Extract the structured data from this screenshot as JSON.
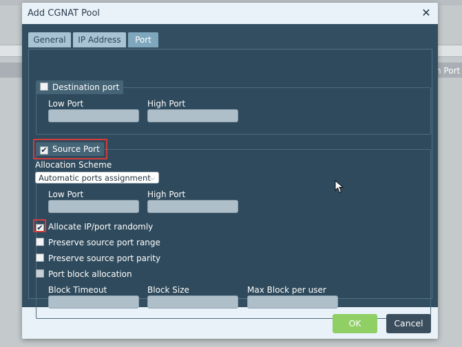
{
  "background": {
    "column_header": "n Port"
  },
  "dialog": {
    "title": "Add CGNAT Pool",
    "close_glyph": "✕",
    "tabs": [
      {
        "label": "General",
        "active": false
      },
      {
        "label": "IP Address",
        "active": false
      },
      {
        "label": "Port",
        "active": true
      }
    ],
    "destination_port": {
      "legend": "Destination port",
      "checked": false,
      "low_port_label": "Low Port",
      "high_port_label": "High Port",
      "low_port_value": "",
      "high_port_value": ""
    },
    "source_port": {
      "legend": "Source Port",
      "checked": true,
      "allocation_scheme_label": "Allocation Scheme",
      "allocation_scheme_value": "Automatic ports assignment",
      "low_port_label": "Low Port",
      "high_port_label": "High Port",
      "low_port_value": "",
      "high_port_value": "",
      "options": [
        {
          "label": "Allocate IP/port randomly",
          "checked": true
        },
        {
          "label": "Preserve source port range",
          "checked": false
        },
        {
          "label": "Preserve source port parity",
          "checked": false
        },
        {
          "label": "Port block allocation",
          "checked": false
        }
      ],
      "block_timeout_label": "Block Timeout",
      "block_size_label": "Block Size",
      "max_block_label": "Max Block per user",
      "block_timeout_value": "",
      "block_size_value": "",
      "max_block_value": ""
    },
    "buttons": {
      "ok": "OK",
      "cancel": "Cancel"
    }
  },
  "colors": {
    "accent_ok": "#8fcf64",
    "cancel": "#3b4e5d",
    "panel": "#324e60",
    "highlight": "#d63c3c"
  }
}
